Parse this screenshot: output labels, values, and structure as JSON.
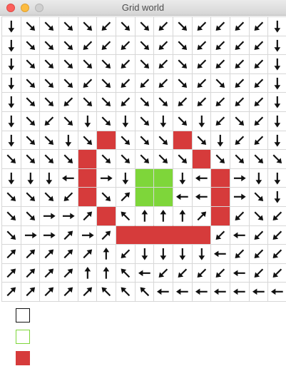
{
  "window": {
    "title": "Grid world"
  },
  "colors": {
    "empty": "#ffffff",
    "goal": "#7ed63a",
    "wall": "#d63b3b",
    "arrow": "#111111",
    "legend_empty_border": "#111111",
    "legend_goal_border": "#7ed63a"
  },
  "grid": {
    "rows": 15,
    "cols": 15,
    "cells": [
      [
        "S",
        "SE",
        "SE",
        "SE",
        "SE",
        "SW",
        "SE",
        "SE",
        "SW",
        "SE",
        "SW",
        "SW",
        "SW",
        "SW",
        "S"
      ],
      [
        "S",
        "SE",
        "SE",
        "SE",
        "SW",
        "SW",
        "SW",
        "SE",
        "SW",
        "SE",
        "SW",
        "SW",
        "SW",
        "SW",
        "S"
      ],
      [
        "S",
        "SE",
        "SE",
        "SE",
        "SE",
        "SE",
        "SW",
        "SE",
        "SW",
        "SE",
        "SW",
        "SW",
        "SW",
        "SW",
        "S"
      ],
      [
        "S",
        "SE",
        "SE",
        "SE",
        "SW",
        "SE",
        "SW",
        "SW",
        "SW",
        "SE",
        "SW",
        "SE",
        "SW",
        "SW",
        "S"
      ],
      [
        "S",
        "SE",
        "SE",
        "SW",
        "SE",
        "SE",
        "SW",
        "SE",
        "SE",
        "SW",
        "SW",
        "SW",
        "SW",
        "SW",
        "S"
      ],
      [
        "S",
        "SE",
        "SW",
        "SE",
        "S",
        "SE",
        "S",
        "SE",
        "S",
        "SE",
        "S",
        "SW",
        "SE",
        "SW",
        "S"
      ],
      [
        "S",
        "SE",
        "SE",
        "S",
        "SE",
        "wall",
        "SE",
        "SE",
        "SE",
        "wall",
        "SE",
        "S",
        "SW",
        "SW",
        "S"
      ],
      [
        "SE",
        "SE",
        "SE",
        "SE",
        "wall",
        "SE",
        "SE",
        "SE",
        "SE",
        "SE",
        "wall",
        "SE",
        "SE",
        "SE",
        "SE"
      ],
      [
        "S",
        "S",
        "S",
        "W",
        "wall",
        "E",
        "S",
        "goal",
        "goal",
        "S",
        "W",
        "wall",
        "E",
        "S",
        "S"
      ],
      [
        "SE",
        "SE",
        "SE",
        "SW",
        "wall",
        "SE",
        "NE",
        "goal",
        "goal",
        "W",
        "W",
        "wall",
        "E",
        "SE",
        "S"
      ],
      [
        "SE",
        "SE",
        "E",
        "E",
        "NE",
        "wall",
        "NW",
        "N",
        "N",
        "N",
        "NE",
        "wall",
        "SW",
        "SE",
        "SW"
      ],
      [
        "SE",
        "E",
        "E",
        "NE",
        "E",
        "NE",
        "wall",
        "wall",
        "wall",
        "wall",
        "wall",
        "SW",
        "W",
        "SW",
        "SW"
      ],
      [
        "NE",
        "NE",
        "NE",
        "NE",
        "NE",
        "N",
        "SW",
        "S",
        "S",
        "S",
        "S",
        "W",
        "SW",
        "SW",
        "SW"
      ],
      [
        "NE",
        "NE",
        "NE",
        "NE",
        "N",
        "N",
        "NW",
        "W",
        "SW",
        "SW",
        "SW",
        "SW",
        "W",
        "SW",
        "SW"
      ],
      [
        "NE",
        "NE",
        "NE",
        "NE",
        "NE",
        "NW",
        "NW",
        "NW",
        "W",
        "W",
        "W",
        "W",
        "W",
        "W",
        "W"
      ]
    ]
  },
  "legend": [
    {
      "kind": "empty"
    },
    {
      "kind": "goal"
    },
    {
      "kind": "wall"
    }
  ]
}
